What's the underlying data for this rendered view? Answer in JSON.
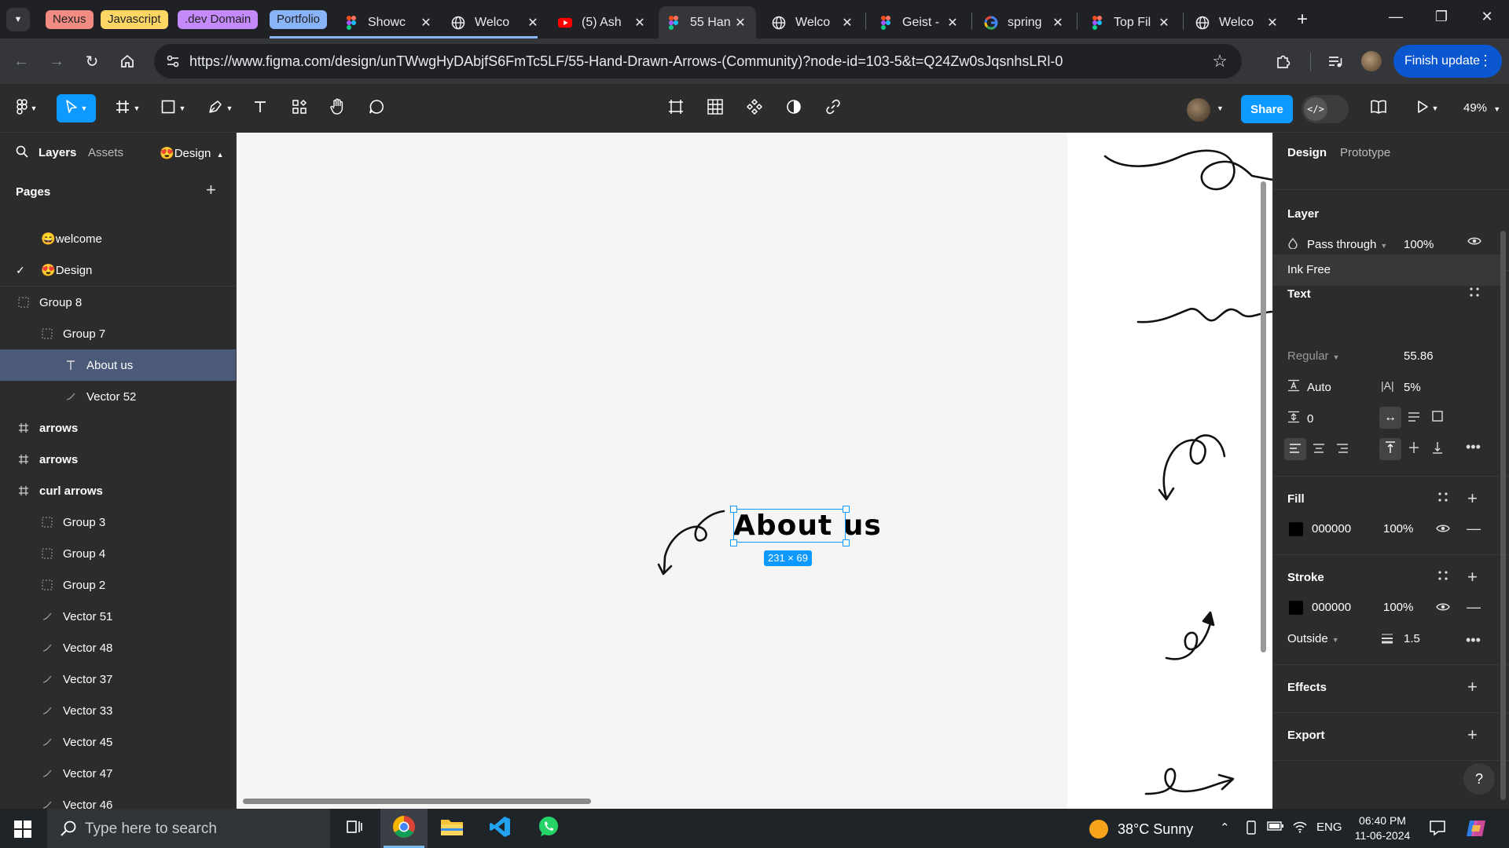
{
  "browser": {
    "tab_groups": [
      {
        "label": "Nexus",
        "bg": "#f28b82",
        "fg": "#202124"
      },
      {
        "label": "Javascript",
        "bg": "#fdd663",
        "fg": "#202124"
      },
      {
        "label": ".dev Domain",
        "bg": "#c58af9",
        "fg": "#202124"
      },
      {
        "label": "Portfolio",
        "bg": "#8ab4f8",
        "fg": "#202124"
      }
    ],
    "tabs": [
      {
        "title": "Showc",
        "icon": "figma-icon"
      },
      {
        "title": "Welco",
        "icon": "globe-icon"
      },
      {
        "title": "(5) Ash",
        "icon": "youtube-icon"
      },
      {
        "title": "55 Han",
        "icon": "figma-icon",
        "active": true
      },
      {
        "title": "Welco",
        "icon": "globe-icon"
      },
      {
        "title": "Geist -",
        "icon": "figma-icon"
      },
      {
        "title": "spring",
        "icon": "google-icon"
      },
      {
        "title": "Top Fil",
        "icon": "figma-icon"
      },
      {
        "title": "Welco",
        "icon": "globe-icon"
      }
    ],
    "url": "https://www.figma.com/design/unTWwgHyDAbjfS6FmTc5LF/55-Hand-Drawn-Arrows-(Community)?node-id=103-5&t=Q24Zw0sJqsnhsLRl-0",
    "finish_update_label": "Finish update"
  },
  "figma_toolbar": {
    "share_label": "Share",
    "zoom": "49%"
  },
  "left_panel": {
    "tabs": {
      "layers": "Layers",
      "assets": "Assets",
      "page_switch": "Design"
    },
    "pages_heading": "Pages",
    "pages": [
      {
        "name": "welcome",
        "emoji": "😄",
        "current": false
      },
      {
        "name": "Design",
        "emoji": "😍",
        "current": true
      }
    ],
    "layers": [
      {
        "name": "Group 8",
        "indent": 0,
        "kind": "group"
      },
      {
        "name": "Group 7",
        "indent": 1,
        "kind": "group"
      },
      {
        "name": "About us",
        "indent": 2,
        "kind": "text",
        "selected": true
      },
      {
        "name": "Vector 52",
        "indent": 2,
        "kind": "vector"
      },
      {
        "name": "arrows",
        "indent": 0,
        "kind": "frame"
      },
      {
        "name": "arrows",
        "indent": 0,
        "kind": "frame"
      },
      {
        "name": "curl arrows",
        "indent": 0,
        "kind": "frame"
      },
      {
        "name": "Group 3",
        "indent": 1,
        "kind": "group"
      },
      {
        "name": "Group 4",
        "indent": 1,
        "kind": "group"
      },
      {
        "name": "Group 2",
        "indent": 1,
        "kind": "group"
      },
      {
        "name": "Vector 51",
        "indent": 1,
        "kind": "vector"
      },
      {
        "name": "Vector 48",
        "indent": 1,
        "kind": "vector"
      },
      {
        "name": "Vector 37",
        "indent": 1,
        "kind": "vector"
      },
      {
        "name": "Vector 33",
        "indent": 1,
        "kind": "vector"
      },
      {
        "name": "Vector 45",
        "indent": 1,
        "kind": "vector"
      },
      {
        "name": "Vector 47",
        "indent": 1,
        "kind": "vector"
      },
      {
        "name": "Vector 46",
        "indent": 1,
        "kind": "vector"
      }
    ]
  },
  "canvas": {
    "selected_text": "About us",
    "dimensions_badge": "231 × 69"
  },
  "right_panel": {
    "tabs": {
      "design": "Design",
      "prototype": "Prototype"
    },
    "layer": {
      "heading": "Layer",
      "blend": "Pass through",
      "opacity": "100%"
    },
    "text": {
      "heading": "Text",
      "font": "Ink Free",
      "weight": "Regular",
      "size": "55.86",
      "line_height": "Auto",
      "letter_spacing": "5%",
      "paragraph_spacing": "0"
    },
    "fill": {
      "heading": "Fill",
      "hex": "000000",
      "opacity": "100%"
    },
    "stroke": {
      "heading": "Stroke",
      "hex": "000000",
      "opacity": "100%",
      "position": "Outside",
      "weight": "1.5"
    },
    "effects_heading": "Effects",
    "export_heading": "Export",
    "help_label": "?"
  },
  "taskbar": {
    "search_placeholder": "Type here to search",
    "weather": "38°C  Sunny",
    "language": "ENG",
    "time": "06:40 PM",
    "date": "11-06-2024"
  }
}
